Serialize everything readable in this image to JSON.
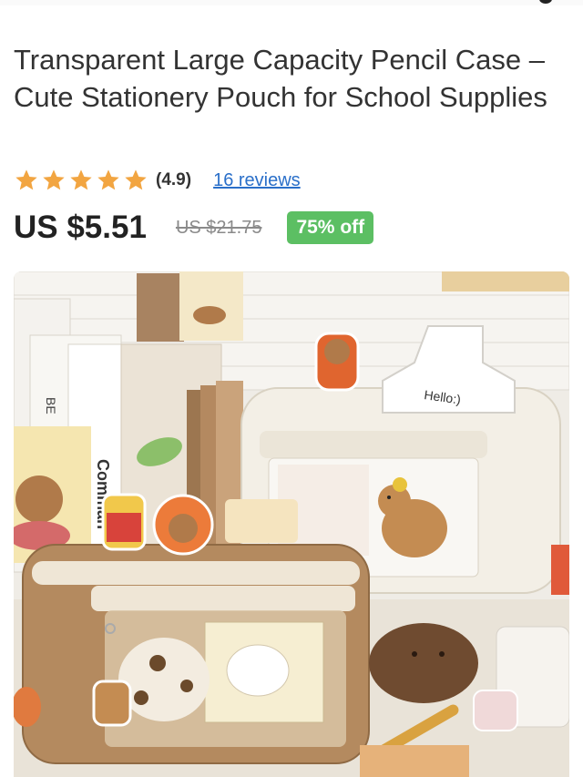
{
  "product": {
    "title": "Transparent Large Capacity Pencil Case – Cute Stationery Pouch for School Supplies",
    "rating": "(4.9)",
    "stars": 5,
    "reviews_label": "16 reviews",
    "price": "US $5.51",
    "original_price": "US $21.75",
    "discount": "75% off"
  },
  "image": {
    "alt_subject": "pencil-case-photo",
    "clip_text": "Hello:)",
    "book_text": "Comman"
  },
  "colors": {
    "star": "#f2a541",
    "link": "#2a6fc9",
    "badge": "#5cbf63"
  }
}
